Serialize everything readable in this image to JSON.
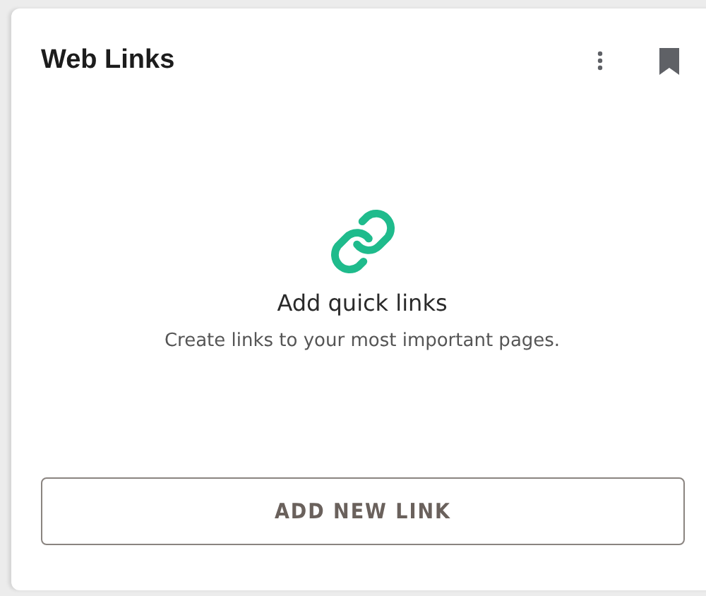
{
  "card": {
    "title": "Web Links",
    "empty_state": {
      "heading": "Add quick links",
      "description": "Create links to your most important pages."
    },
    "button": "ADD NEW LINK"
  }
}
